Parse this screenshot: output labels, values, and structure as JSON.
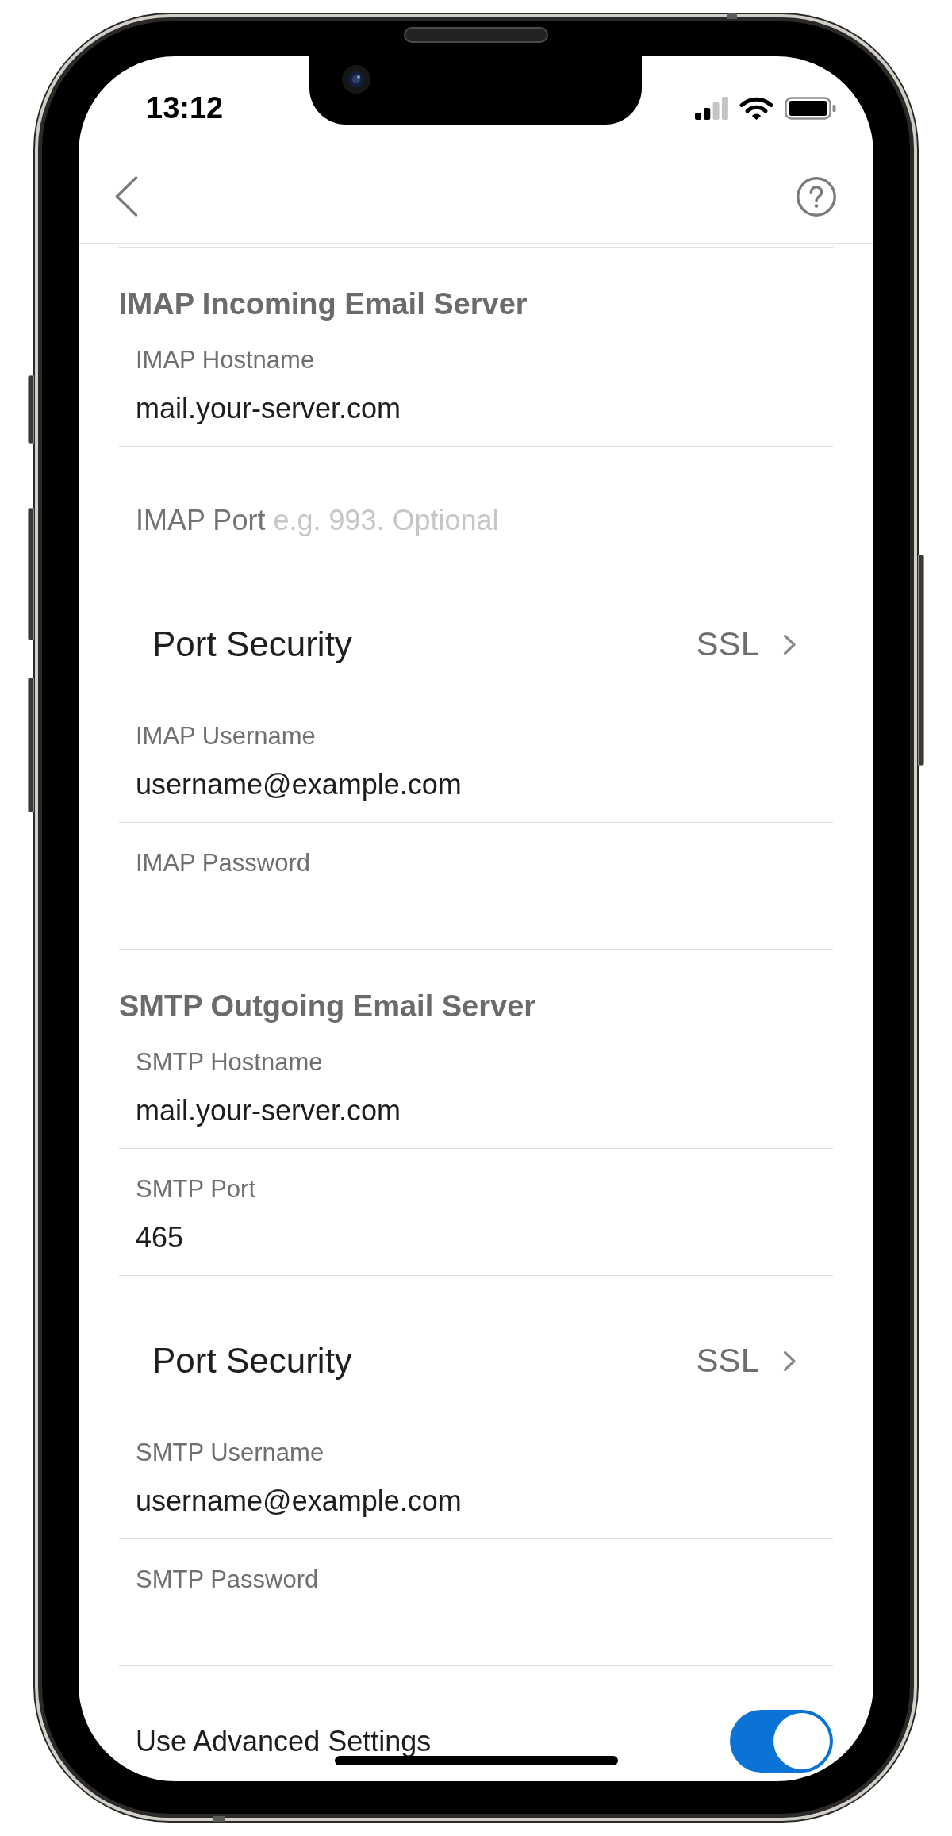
{
  "status_bar": {
    "time": "13:12"
  },
  "sections": [
    {
      "title": "IMAP Incoming Email Server",
      "fields": [
        {
          "kind": "text",
          "label": "IMAP Hostname",
          "value": "mail.your-server.com"
        },
        {
          "kind": "text",
          "label": "IMAP Port",
          "placeholder": "e.g. 993. Optional"
        },
        {
          "kind": "picker",
          "label": "Port Security",
          "value": "SSL"
        },
        {
          "kind": "text",
          "label": "IMAP Username",
          "value": "username@example.com"
        },
        {
          "kind": "password",
          "label": "IMAP Password"
        }
      ]
    },
    {
      "title": "SMTP Outgoing Email Server",
      "fields": [
        {
          "kind": "text",
          "label": "SMTP Hostname",
          "value": "mail.your-server.com"
        },
        {
          "kind": "text",
          "label": "SMTP Port",
          "value": "465"
        },
        {
          "kind": "picker",
          "label": "Port Security",
          "value": "SSL"
        },
        {
          "kind": "text",
          "label": "SMTP Username",
          "value": "username@example.com"
        },
        {
          "kind": "password",
          "label": "SMTP Password"
        }
      ]
    }
  ],
  "advanced_settings": {
    "label": "Use Advanced Settings",
    "on": true
  }
}
